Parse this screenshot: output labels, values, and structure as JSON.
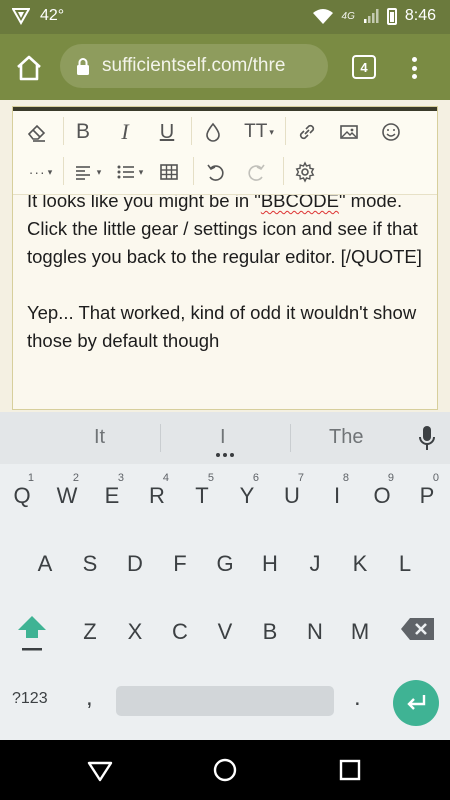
{
  "status_bar": {
    "temperature": "42°",
    "network": "4G",
    "time": "8:46"
  },
  "browser": {
    "url": "sufficientself.com/thre",
    "tab_count": "4"
  },
  "toolbar": {
    "row1": [
      "eraser-icon",
      "bold",
      "italic",
      "underline",
      "color-drop-icon",
      "text-size",
      "link-icon",
      "image-icon",
      "smiley-icon"
    ],
    "row2": [
      "more",
      "align",
      "list",
      "table-icon",
      "undo-icon",
      "redo-icon",
      "settings-icon"
    ],
    "bold_label": "B",
    "italic_label": "I",
    "underline_label": "U",
    "textsize_label": "TT",
    "more_label": "···"
  },
  "editor": {
    "lines": [
      "It looks like you might be in \"",
      "BBCODE",
      "\" mode. Click the little gear / settings icon and see if that toggles you back to the regular editor. [/QUOTE]",
      "Yep... That worked, kind of odd it wouldn't show those by default though"
    ]
  },
  "keyboard": {
    "suggestions": [
      "It",
      "I",
      "The"
    ],
    "row1": [
      {
        "key": "Q",
        "hint": "1"
      },
      {
        "key": "W",
        "hint": "2"
      },
      {
        "key": "E",
        "hint": "3"
      },
      {
        "key": "R",
        "hint": "4"
      },
      {
        "key": "T",
        "hint": "5"
      },
      {
        "key": "Y",
        "hint": "6"
      },
      {
        "key": "U",
        "hint": "7"
      },
      {
        "key": "I",
        "hint": "8"
      },
      {
        "key": "O",
        "hint": "9"
      },
      {
        "key": "P",
        "hint": "0"
      }
    ],
    "row2": [
      "A",
      "S",
      "D",
      "F",
      "G",
      "H",
      "J",
      "K",
      "L"
    ],
    "row3": [
      "Z",
      "X",
      "C",
      "V",
      "B",
      "N",
      "M"
    ],
    "symbols_label": "?123",
    "comma_label": ",",
    "period_label": "."
  },
  "colors": {
    "status_bg": "#6b7a3d",
    "browser_bg": "#7a8b43",
    "page_bg": "#f4f0e2",
    "enter_key": "#3fb394"
  }
}
